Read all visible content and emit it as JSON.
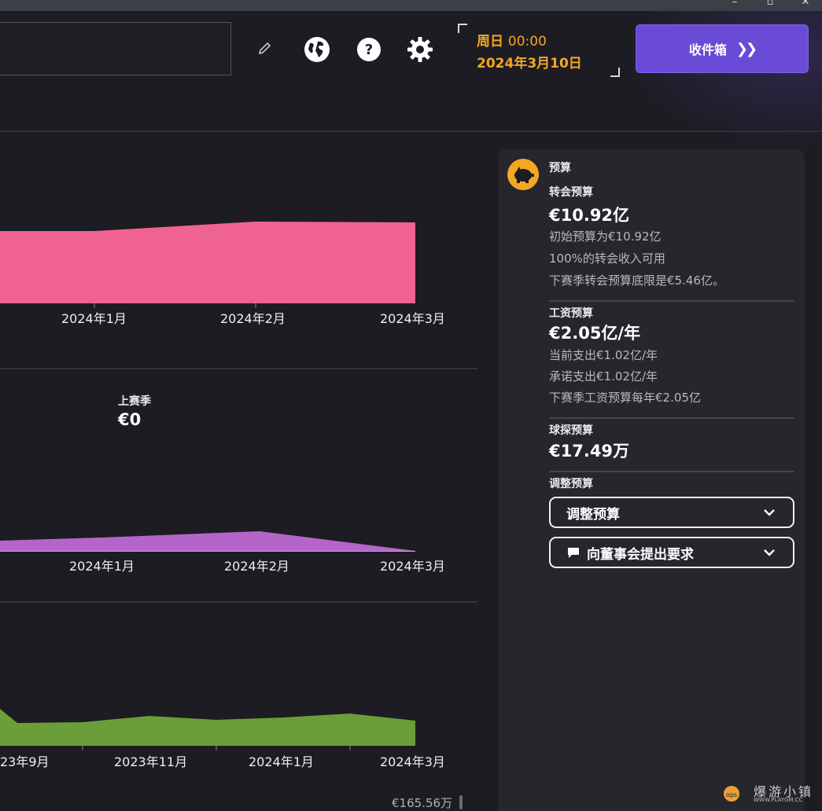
{
  "header": {
    "datetime": {
      "day": "周日",
      "time": "00:00",
      "date": "2024年3月10日"
    },
    "inbox_button": "收件箱"
  },
  "charts": [
    {
      "name": "transfer-budget-chart",
      "color": "#f06292",
      "x_ticks": [
        "2024年1月",
        "2024年2月",
        "2024年3月"
      ]
    },
    {
      "name": "wage-chart",
      "color": "#b565c9",
      "x_ticks": [
        "2024年1月",
        "2024年2月",
        "2024年3月"
      ],
      "last_season": {
        "label": "上赛季",
        "value": "€0"
      }
    },
    {
      "name": "balance-chart",
      "color": "#6b9e38",
      "x_ticks": [
        "23年9月",
        "2023年11月",
        "2024年1月",
        "2024年3月"
      ],
      "bottom_value": "€165.56万"
    }
  ],
  "panel": {
    "title": "预算",
    "transfer": {
      "label": "转会预算",
      "value": "€10.92亿",
      "lines": [
        "初始预算为€10.92亿",
        "100%的转会收入可用",
        "下赛季转会预算底限是€5.46亿。"
      ]
    },
    "wage": {
      "label": "工资预算",
      "value": "€2.05亿/年",
      "lines": [
        "当前支出€1.02亿/年",
        "承诺支出€1.02亿/年",
        "下赛季工资预算每年€2.05亿"
      ]
    },
    "scouting": {
      "label": "球探预算",
      "value": "€17.49万"
    },
    "adjust": {
      "label": "调整预算",
      "dropdown1": "调整预算",
      "dropdown2": "向董事会提出要求"
    }
  },
  "watermark": {
    "line1": "爆游小镇",
    "line2": "WWW.PLAYGM.CC"
  },
  "colors": {
    "accent": "#6a4bd6",
    "date": "#f5a623",
    "pink": "#f06292",
    "purple": "#b565c9",
    "green": "#6b9e38"
  }
}
